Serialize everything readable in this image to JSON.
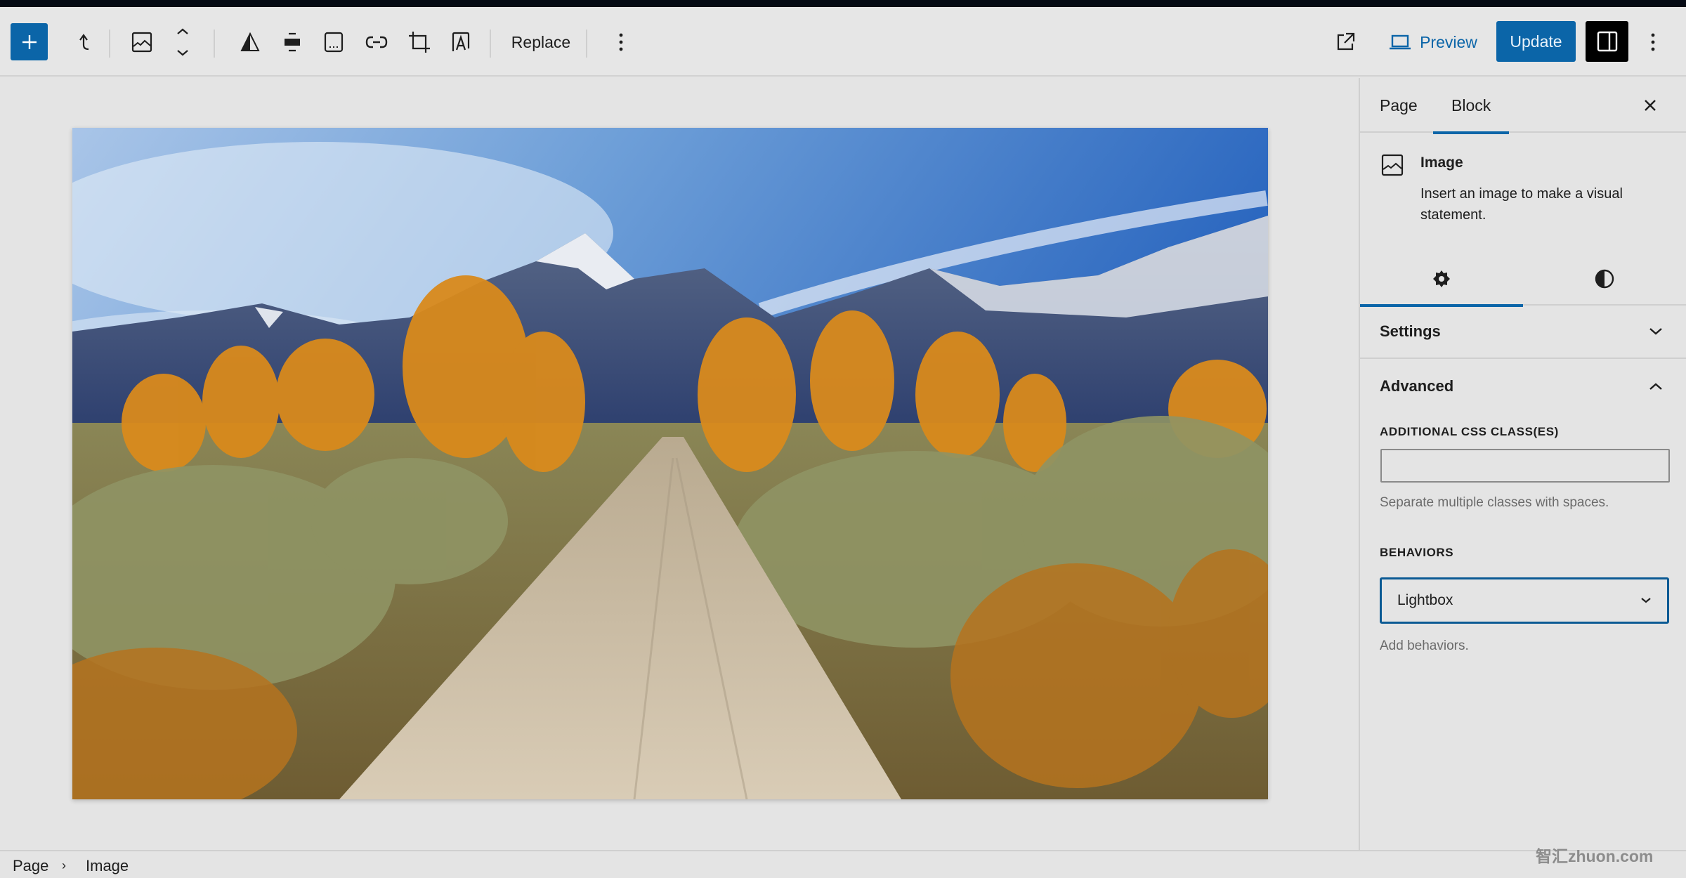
{
  "toolbar": {
    "add_block": "plus-icon",
    "parent_select": "arrow-up-left-icon",
    "block_type": "image-icon",
    "move": "chevron-up-down-icon",
    "tools": [
      "duotone-icon",
      "align-icon",
      "caption-icon",
      "link-icon",
      "crop-icon",
      "text-over-image-icon"
    ],
    "replace_label": "Replace",
    "more_options": "more-vertical-icon",
    "view_post": "external-link-icon",
    "preview_label": "Preview",
    "update_label": "Update",
    "settings_toggle": "sidebar-panel-icon",
    "options": "more-vertical-icon"
  },
  "canvas": {
    "image_alt": "Dirt road through autumn trees and sagebrush leading toward snow-capped mountains under a blue sky"
  },
  "sidebar": {
    "tabs": [
      {
        "label": "Page",
        "active": false
      },
      {
        "label": "Block",
        "active": true
      }
    ],
    "block": {
      "title": "Image",
      "description": "Insert an image to make a visual statement."
    },
    "icon_tabs": [
      {
        "icon": "gear-icon",
        "label": "Settings",
        "active": true
      },
      {
        "icon": "contrast-icon",
        "label": "Styles",
        "active": false
      }
    ],
    "panels": {
      "settings": {
        "title": "Settings",
        "expanded": false
      },
      "advanced": {
        "title": "Advanced",
        "expanded": true,
        "css_label": "Additional CSS class(es)",
        "css_value": "",
        "css_help": "Separate multiple classes with spaces.",
        "behaviors_label": "Behaviors",
        "behaviors_value": "Lightbox",
        "behaviors_help": "Add behaviors."
      }
    }
  },
  "breadcrumb": [
    "Page",
    "Image"
  ],
  "watermark": "智汇zhuon.com",
  "colors": {
    "accent": "#0b65a8",
    "background": "#e4e4e4",
    "text": "#1e1e1e"
  }
}
